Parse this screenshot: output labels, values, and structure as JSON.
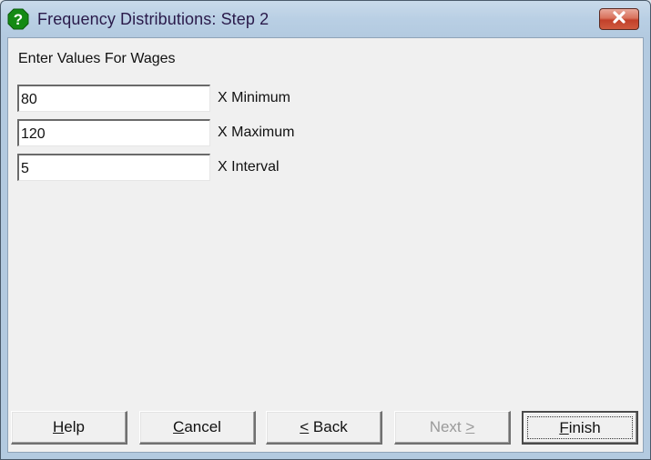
{
  "window": {
    "title": "Frequency Distributions: Step 2",
    "icon": "help-question-icon",
    "close_icon": "close-icon"
  },
  "form": {
    "group_label": "Enter Values For Wages",
    "fields": [
      {
        "value": "80",
        "label": "X Minimum"
      },
      {
        "value": "120",
        "label": "X Maximum"
      },
      {
        "value": "5",
        "label": "X Interval"
      }
    ]
  },
  "buttons": {
    "help": {
      "mnemonic": "H",
      "rest": "elp",
      "enabled": true
    },
    "cancel": {
      "mnemonic": "C",
      "rest": "ancel",
      "enabled": true
    },
    "back": {
      "prefix": "",
      "mnemonic": "<",
      "rest": " Back",
      "enabled": true
    },
    "next": {
      "prefix": "Next ",
      "mnemonic": ">",
      "rest": "",
      "enabled": false
    },
    "finish": {
      "mnemonic": "F",
      "rest": "inish",
      "enabled": true,
      "default": true
    }
  },
  "colors": {
    "titlebar": "#b9cfe4",
    "client_bg": "#f0f0f0",
    "close_button": "#c2402a",
    "help_icon": "#1f8a1f",
    "disabled_text": "#9a9a9a"
  }
}
